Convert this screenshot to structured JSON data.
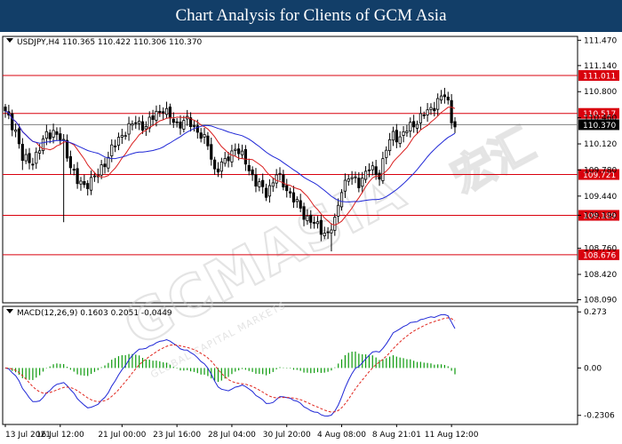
{
  "header": {
    "title": "Chart Analysis for Clients of GCM Asia"
  },
  "watermark": {
    "text": "GCMASIA",
    "subtext": "GLOBAL CAPITAL MARKETS",
    "cjk": "宏汇"
  },
  "chart_data": [
    {
      "type": "candlestick",
      "title": "USDJPY,H4 110.365 110.422 110.306 110.370",
      "symbol": "USDJPY",
      "timeframe": "H4",
      "ohlc_readout": {
        "open": 110.365,
        "high": 110.422,
        "low": 110.306,
        "close": 110.37
      },
      "ylim": [
        108.05,
        111.52
      ],
      "y_ticks": [
        "111.470",
        "111.140",
        "110.800",
        "110.460",
        "110.120",
        "109.780",
        "109.440",
        "109.190",
        "108.760",
        "108.420",
        "108.090"
      ],
      "x_labels": [
        "13 Jul 2021",
        "16 Jul 12:00",
        "21 Jul 00:00",
        "23 Jul 16:00",
        "28 Jul 04:00",
        "30 Jul 20:00",
        "4 Aug 08:00",
        "8 Aug 21:01",
        "11 Aug 12:00"
      ],
      "x_label_index": [
        0,
        16,
        34,
        50,
        66,
        82,
        98,
        114,
        130
      ],
      "bar_count": 132,
      "levels": [
        {
          "value": 111.011,
          "label": "111.011",
          "color": "#d9000d"
        },
        {
          "value": 110.517,
          "label": "110.517",
          "color": "#d9000d"
        },
        {
          "value": 109.721,
          "label": "109.721",
          "color": "#d9000d"
        },
        {
          "value": 109.189,
          "label": "109.189",
          "color": "#d9000d"
        },
        {
          "value": 108.676,
          "label": "108.676",
          "color": "#d9000d"
        }
      ],
      "current_price": {
        "value": 110.37,
        "label": "110.370",
        "color": "#000000"
      },
      "close_waypoints": [
        [
          0,
          110.52
        ],
        [
          3,
          110.3
        ],
        [
          5,
          109.92
        ],
        [
          8,
          109.9
        ],
        [
          10,
          110.05
        ],
        [
          12,
          110.25
        ],
        [
          14,
          110.28
        ],
        [
          17,
          110.12
        ],
        [
          19,
          109.85
        ],
        [
          21,
          109.62
        ],
        [
          23,
          109.58
        ],
        [
          27,
          109.72
        ],
        [
          31,
          110.05
        ],
        [
          35,
          110.3
        ],
        [
          38,
          110.4
        ],
        [
          41,
          110.35
        ],
        [
          44,
          110.52
        ],
        [
          46,
          110.58
        ],
        [
          48,
          110.45
        ],
        [
          50,
          110.38
        ],
        [
          53,
          110.42
        ],
        [
          56,
          110.3
        ],
        [
          59,
          110.1
        ],
        [
          61,
          109.78
        ],
        [
          64,
          109.88
        ],
        [
          67,
          110.08
        ],
        [
          70,
          109.88
        ],
        [
          73,
          109.62
        ],
        [
          76,
          109.48
        ],
        [
          79,
          109.72
        ],
        [
          81,
          109.6
        ],
        [
          84,
          109.4
        ],
        [
          87,
          109.2
        ],
        [
          90,
          109.08
        ],
        [
          92,
          109.0
        ],
        [
          94,
          108.95
        ],
        [
          96,
          109.1
        ],
        [
          98,
          109.55
        ],
        [
          100,
          109.68
        ],
        [
          103,
          109.62
        ],
        [
          106,
          109.8
        ],
        [
          109,
          109.72
        ],
        [
          111,
          110.05
        ],
        [
          113,
          110.25
        ],
        [
          115,
          110.2
        ],
        [
          118,
          110.35
        ],
        [
          120,
          110.42
        ],
        [
          122,
          110.5
        ],
        [
          124,
          110.58
        ],
        [
          126,
          110.68
        ],
        [
          128,
          110.75
        ],
        [
          129,
          110.65
        ],
        [
          130,
          110.45
        ],
        [
          131,
          110.37
        ]
      ],
      "ma_fast_color": "#d91e1e",
      "ma_slow_color": "#1f27d6"
    },
    {
      "type": "macd",
      "title": "MACD(12,26,9) 0.1603 0.2051 -0.0449",
      "params": [
        12,
        26,
        9
      ],
      "readout": {
        "macd": 0.1603,
        "signal": 0.2051,
        "histogram": -0.0449
      },
      "ylim": [
        -0.275,
        0.3
      ],
      "y_ticks": [
        "0.273",
        "0.00",
        "-0.2306"
      ],
      "macd_color": "#1f27d6",
      "signal_color": "#e0261e",
      "histogram_color": "#0c9a0c"
    }
  ]
}
